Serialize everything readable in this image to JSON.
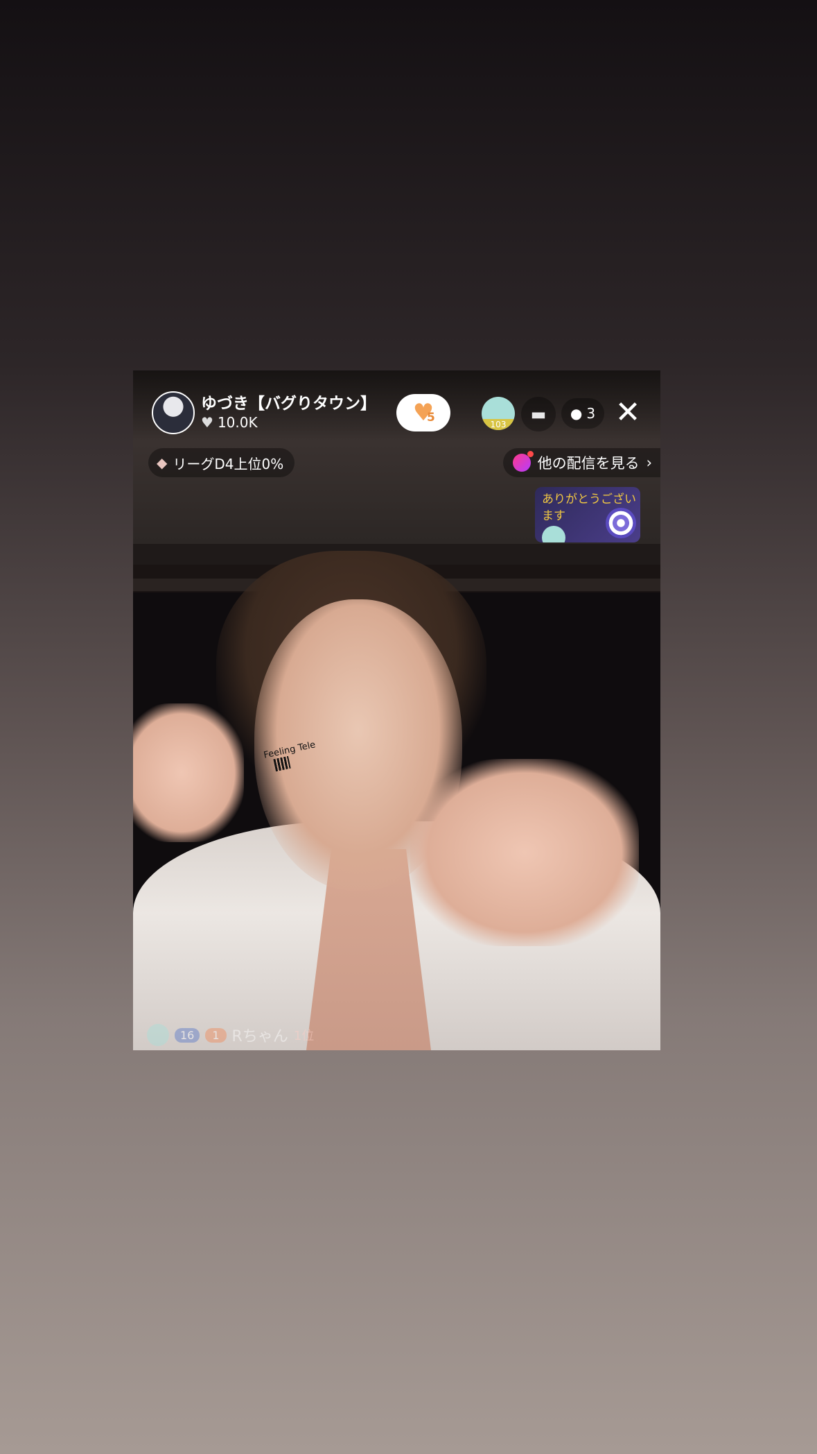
{
  "streamer": {
    "name": "ゆづき【バグりタウン】",
    "likes": "10.0K",
    "heart_count": "5"
  },
  "viewer": {
    "level_badge": "103",
    "count": "3"
  },
  "league": {
    "label": "リーグD4上位0%"
  },
  "other_streams": {
    "label": "他の配信を見る"
  },
  "thanks_sticker": {
    "text": "ありがとうございます"
  },
  "comment": {
    "level": "16",
    "hearts": "1",
    "name": "Rちゃん",
    "rank": "1位"
  },
  "colors": {
    "accent_heart": "#f4a255",
    "thanks_text": "#f0c742",
    "viewer_avatar": "#a9dfd9"
  }
}
